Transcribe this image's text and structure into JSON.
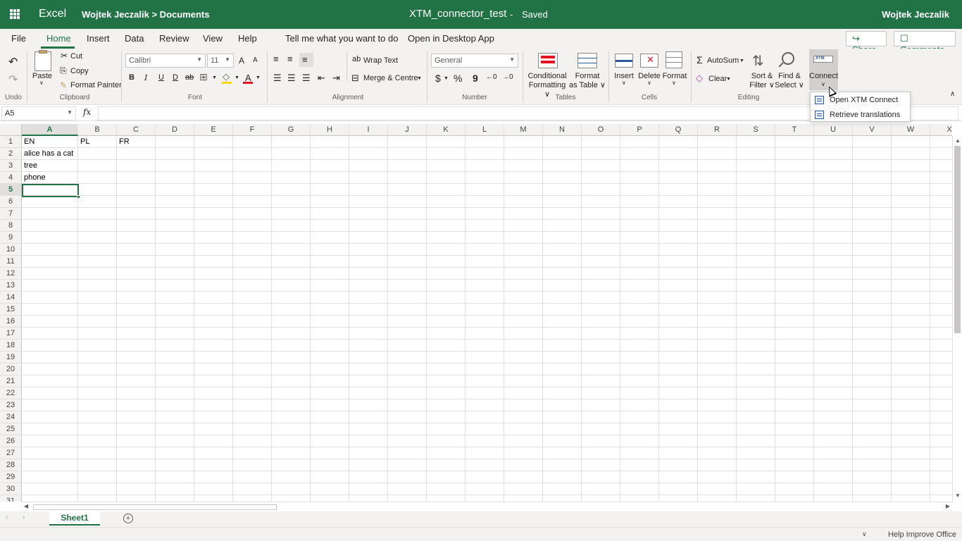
{
  "titlebar": {
    "app_name": "Excel",
    "breadcrumb": "Wojtek Jeczalik > Documents",
    "document_name": "XTM_connector_test",
    "separator": "-",
    "save_status": "Saved",
    "user_name": "Wojtek Jeczalik",
    "color": "#217346"
  },
  "menu": {
    "tabs": [
      "File",
      "Home",
      "Insert",
      "Data",
      "Review",
      "View",
      "Help"
    ],
    "active_tab": "Home",
    "tell_me": "Tell me what you want to do",
    "open_desktop": "Open in Desktop App",
    "share_label": "Share",
    "comments_label": "Comments"
  },
  "ribbon": {
    "undo_group": "Undo",
    "clipboard": {
      "label": "Clipboard",
      "paste": "Paste",
      "cut": "Cut",
      "copy": "Copy",
      "format_painter": "Format Painter"
    },
    "font": {
      "label": "Font",
      "family": "Calibri",
      "size": "11",
      "grow": "A",
      "shrink": "A",
      "bold": "B",
      "italic": "I",
      "underline": "U",
      "double_underline": "D",
      "strikethrough": "ab",
      "font_color": "A"
    },
    "alignment": {
      "label": "Alignment",
      "wrap_text": "Wrap Text",
      "merge_centre": "Merge & Centre"
    },
    "number": {
      "label": "Number",
      "format": "General",
      "currency": "$",
      "percent": "%",
      "comma": "9"
    },
    "tables": {
      "label": "Tables",
      "conditional_formatting_1": "Conditional",
      "conditional_formatting_2": "Formatting",
      "format_table_1": "Format",
      "format_table_2": "as Table"
    },
    "cells": {
      "label": "Cells",
      "insert": "Insert",
      "delete": "Delete",
      "format": "Format"
    },
    "editing": {
      "label": "Editing",
      "autosum": "AutoSum",
      "clear": "Clear",
      "sort_filter_1": "Sort &",
      "sort_filter_2": "Filter",
      "find_select_1": "Find &",
      "find_select_2": "Select"
    },
    "connect": {
      "label": "Connect",
      "logo_text": "XTM"
    }
  },
  "formula_bar": {
    "name_box": "A5",
    "fx": "fx",
    "value": ""
  },
  "grid": {
    "columns": [
      "A",
      "B",
      "C",
      "D",
      "E",
      "F",
      "G",
      "H",
      "I",
      "J",
      "K",
      "L",
      "M",
      "N",
      "O",
      "P",
      "Q",
      "R",
      "S",
      "T",
      "U",
      "V",
      "W",
      "X"
    ],
    "rows": [
      "1",
      "2",
      "3",
      "4",
      "5",
      "6",
      "7",
      "8",
      "9",
      "10",
      "11",
      "12",
      "13",
      "14",
      "15",
      "16",
      "17",
      "18",
      "19",
      "20",
      "21",
      "22",
      "23",
      "24",
      "25",
      "26",
      "27",
      "28",
      "29",
      "30",
      "31"
    ],
    "selected_column": "A",
    "selected_row": "5",
    "cells": {
      "A1": "EN",
      "B1": "PL",
      "C1": "FR",
      "A2": "alice has a cat",
      "A3": "tree",
      "A4": "phone"
    }
  },
  "sheets": {
    "tabs": [
      "Sheet1"
    ],
    "add_symbol": "+"
  },
  "status_bar": {
    "help_improve": "Help Improve Office"
  },
  "dropdown": {
    "items": [
      "Open XTM Connect",
      "Retrieve translations"
    ]
  }
}
